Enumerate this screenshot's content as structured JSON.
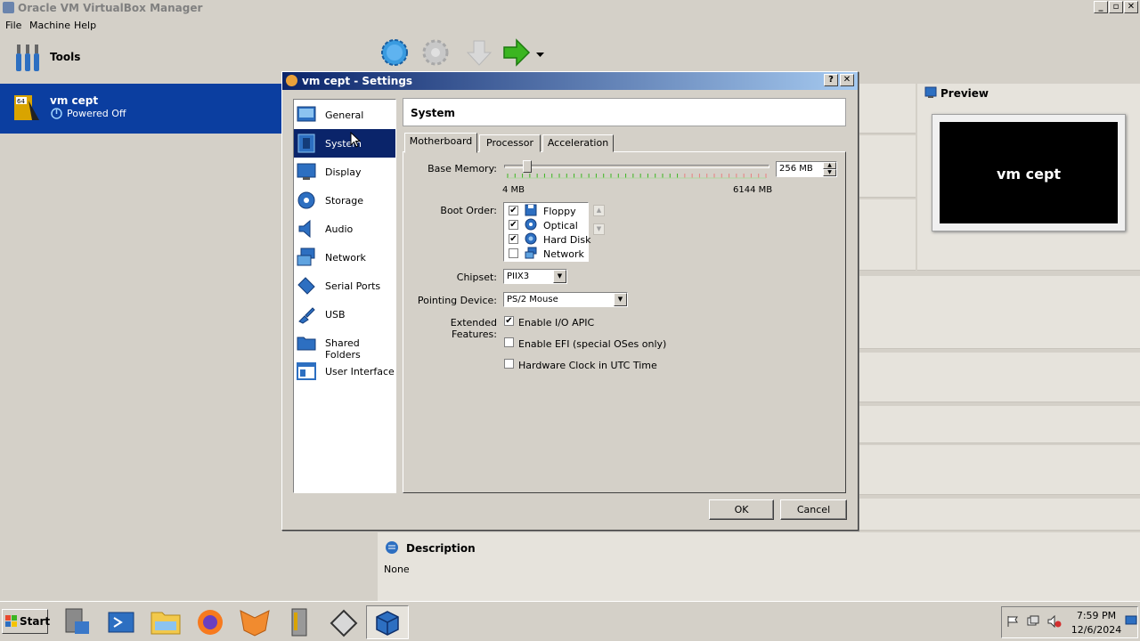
{
  "window": {
    "title": "Oracle VM VirtualBox Manager"
  },
  "menu": [
    "File",
    "Machine",
    "Help"
  ],
  "sidebar": {
    "tools_label": "Tools",
    "vm": {
      "name": "vm cept",
      "state": "Powered Off"
    }
  },
  "toolbar": {
    "icons": [
      "new-vm-icon",
      "settings-icon",
      "discard-icon",
      "start-icon",
      "start-dropdown-icon"
    ]
  },
  "preview": {
    "title": "Preview",
    "screen_text": "vm cept"
  },
  "description": {
    "title": "Description",
    "value": "None"
  },
  "dialog": {
    "title": "vm cept - Settings",
    "help_btn": "?",
    "close_btn": "✕",
    "categories": [
      {
        "label": "General",
        "icon": "general-icon"
      },
      {
        "label": "System",
        "icon": "system-icon"
      },
      {
        "label": "Display",
        "icon": "display-icon"
      },
      {
        "label": "Storage",
        "icon": "storage-icon"
      },
      {
        "label": "Audio",
        "icon": "audio-icon"
      },
      {
        "label": "Network",
        "icon": "network-icon"
      },
      {
        "label": "Serial Ports",
        "icon": "serial-ports-icon"
      },
      {
        "label": "USB",
        "icon": "usb-icon"
      },
      {
        "label": "Shared Folders",
        "icon": "shared-folders-icon"
      },
      {
        "label": "User Interface",
        "icon": "user-interface-icon"
      }
    ],
    "selected_category": "System",
    "section_title": "System",
    "tabs": [
      "Motherboard",
      "Processor",
      "Acceleration"
    ],
    "active_tab": "Motherboard",
    "motherboard": {
      "base_memory_label": "Base Memory:",
      "base_memory_value": "256 MB",
      "memory_min_label": "4 MB",
      "memory_max_label": "6144 MB",
      "memory_fraction": 0.04,
      "boot_order_label": "Boot Order:",
      "boot_order": [
        {
          "label": "Floppy",
          "checked": true
        },
        {
          "label": "Optical",
          "checked": true
        },
        {
          "label": "Hard Disk",
          "checked": true
        },
        {
          "label": "Network",
          "checked": false
        }
      ],
      "chipset_label": "Chipset:",
      "chipset_value": "PIIX3",
      "pointing_label": "Pointing Device:",
      "pointing_value": "PS/2 Mouse",
      "extended_label": "Extended Features:",
      "features": [
        {
          "label": "Enable I/O APIC",
          "checked": true
        },
        {
          "label": "Enable EFI (special OSes only)",
          "checked": false
        },
        {
          "label": "Hardware Clock in UTC Time",
          "checked": false
        }
      ]
    },
    "ok_label": "OK",
    "cancel_label": "Cancel"
  },
  "taskbar": {
    "start_label": "Start",
    "clock_time": "7:59 PM",
    "clock_date": "12/6/2024"
  },
  "colors": {
    "selection": "#0a246a",
    "vm_selection": "#0b3ea0",
    "accent_green": "#3bb521"
  }
}
